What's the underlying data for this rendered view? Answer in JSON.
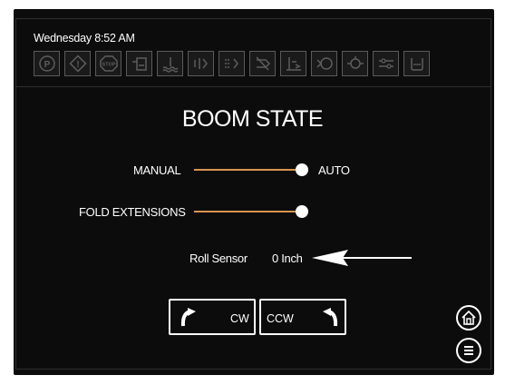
{
  "header": {
    "datetime": "Wednesday 8:52 AM",
    "status_icons": [
      {
        "name": "parking-brake-icon"
      },
      {
        "name": "warning-icon"
      },
      {
        "name": "stop-icon"
      },
      {
        "name": "tank-level-icon"
      },
      {
        "name": "water-temp-icon"
      },
      {
        "name": "boom-section-icon"
      },
      {
        "name": "spray-nozzle-icon"
      },
      {
        "name": "nozzle-off-icon"
      },
      {
        "name": "boom-height-icon"
      },
      {
        "name": "pump-icon"
      },
      {
        "name": "flow-meter-icon"
      },
      {
        "name": "boom-fold-icon"
      },
      {
        "name": "rinse-tank-icon"
      }
    ]
  },
  "main": {
    "title": "BOOM STATE",
    "mode_slider": {
      "left_label": "MANUAL",
      "right_label": "AUTO",
      "value": "AUTO"
    },
    "fold_slider": {
      "label": "FOLD EXTENSIONS",
      "value": "on"
    },
    "roll_sensor": {
      "label": "Roll Sensor",
      "value": "0 Inch"
    },
    "rotate_cw_label": "CW",
    "rotate_ccw_label": "CCW"
  },
  "colors": {
    "track": "#d8944e",
    "background": "#0c0c0c",
    "foreground": "#ffffff"
  }
}
